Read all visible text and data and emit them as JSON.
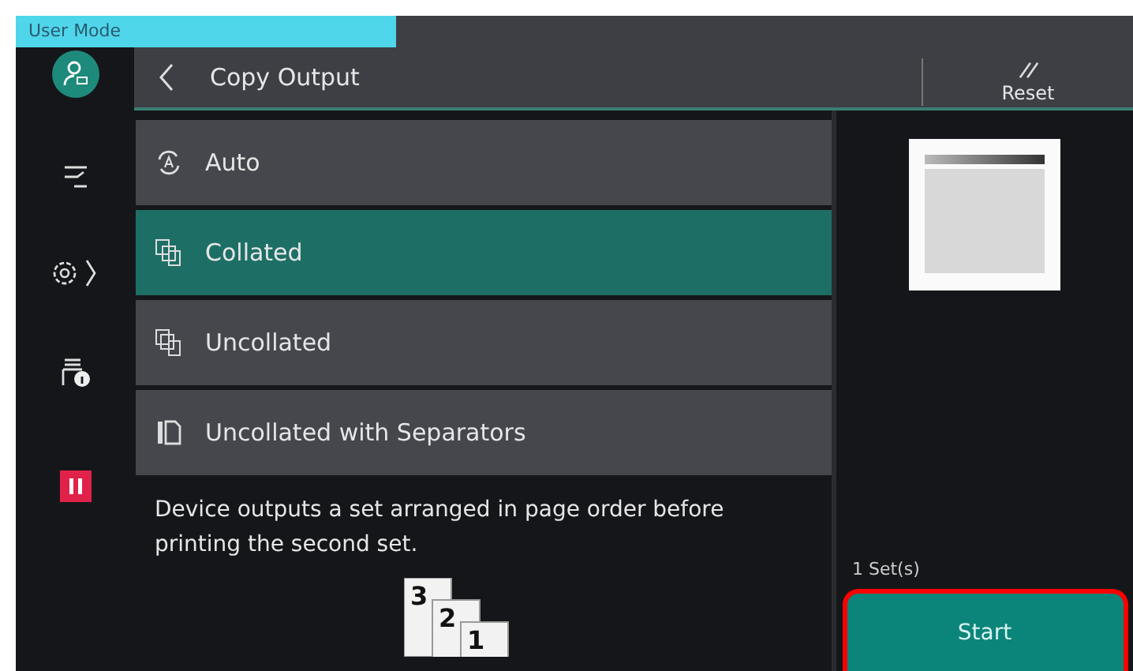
{
  "mode_label": "User Mode",
  "header": {
    "title": "Copy Output",
    "reset": "Reset"
  },
  "options": [
    {
      "label": "Auto",
      "kind": "auto",
      "selected": false
    },
    {
      "label": "Collated",
      "kind": "collated",
      "selected": true
    },
    {
      "label": "Uncollated",
      "kind": "uncollated",
      "selected": false
    },
    {
      "label": "Uncollated with Separators",
      "kind": "separators",
      "selected": false
    }
  ],
  "description": "Device outputs a set arranged in page order before printing the second set.",
  "illustration_pages": [
    "3",
    "2",
    "1"
  ],
  "sets": "1 Set(s)",
  "start": "Start"
}
